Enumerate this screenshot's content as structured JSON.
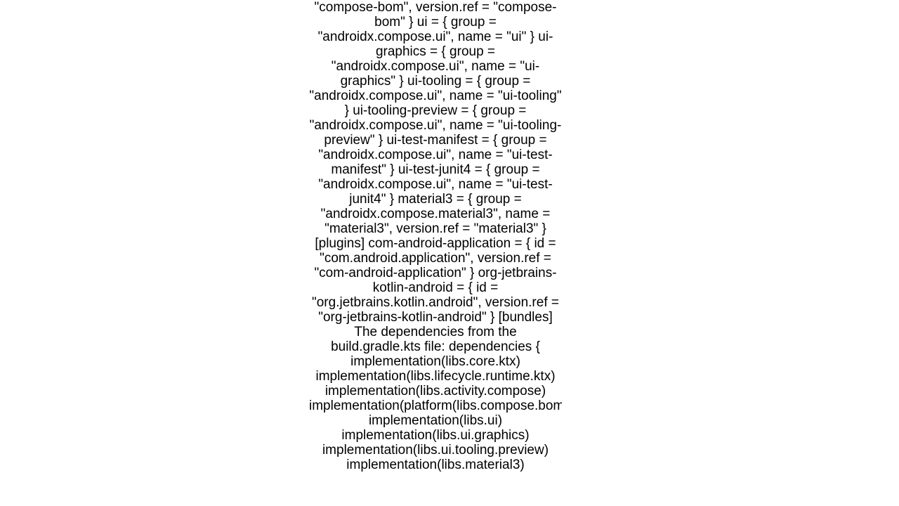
{
  "body": {
    "part1": "\"compose-bom\", version.ref = \"compose-bom\" } ui = { group = \"androidx.compose.ui\", name = \"ui\" } ui-graphics = { group = \"androidx.compose.ui\", name = \"ui-graphics\" } ui-tooling = { group = \"androidx.compose.ui\", name = \"ui-tooling\" } ui-tooling-preview = { group = \"androidx.compose.ui\", name = \"ui-tooling-preview\" } ui-test-manifest = { group = \"androidx.compose.ui\", name = \"ui-test-manifest\" } ui-test-junit4 = { group = \"androidx.compose.ui\", name = \"ui-test-junit4\" } material3 = { group = \"androidx.compose.material3\", name = \"material3\", version.ref = \"material3\" } [plugins] com-android-application = { id = \"com.android.application\", version.ref = \"com-android-application\" } org-jetbrains-kotlin-android = { id = \"org.jetbrains.kotlin.android\", version.ref = \"org-jetbrains-kotlin-android\" }  [bundles]  The dependencies from the build.gradle.kts file: dependencies {     implementation(libs.core.ktx)     implementation(libs.lifecycle.runtime.ktx)     implementation(libs.activity.compose)     implementation(platform(libs.compose.bom))     implementation(libs.ui)     implementation(libs.ui.graphics)     implementation(libs.ui.tooling.preview)     implementation(libs.material3)"
  }
}
